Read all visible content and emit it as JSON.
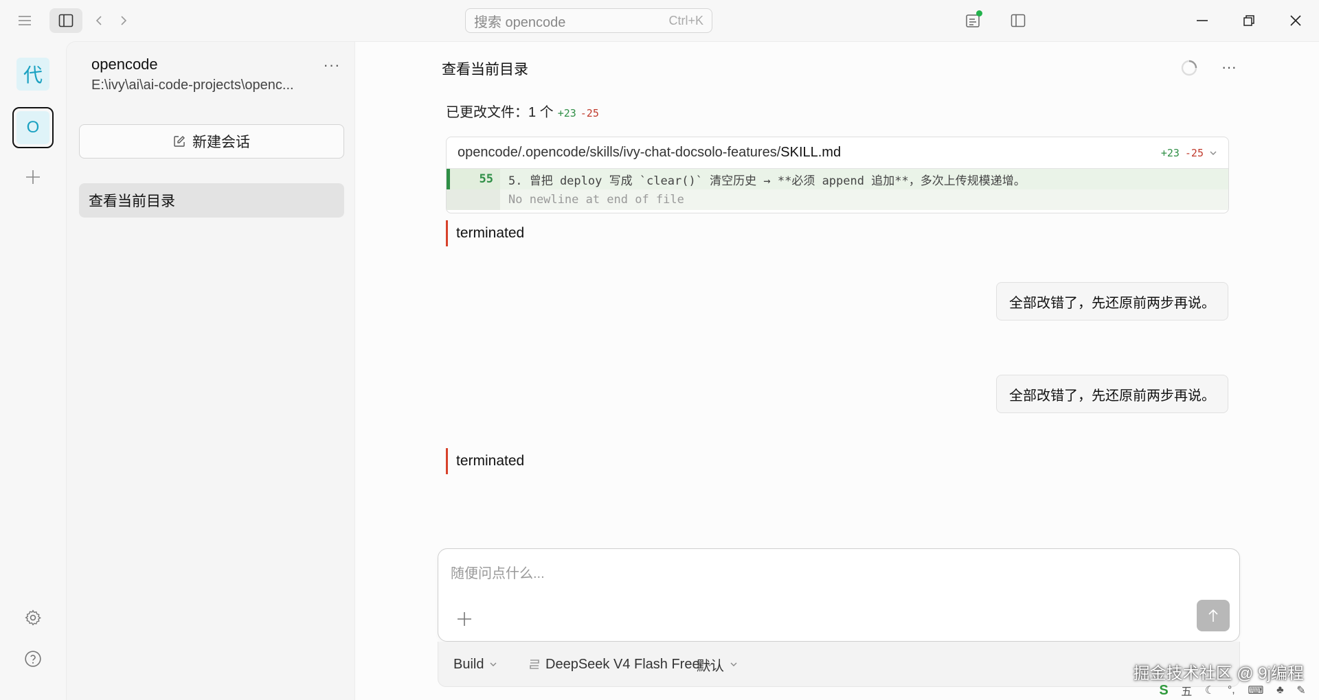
{
  "titlebar": {
    "search_placeholder": "搜索 opencode",
    "search_shortcut": "Ctrl+K",
    "status_dot_color": "#22b24c"
  },
  "rail": {
    "project_avatar_char": "代",
    "active_project_char": "O",
    "avatar_bg": "#dff3f8",
    "avatar_fg": "#1aa1c1"
  },
  "sidebar": {
    "project_name": "opencode",
    "project_path": "E:\\ivy\\ai\\ai-code-projects\\openc...",
    "new_session_label": "新建会话",
    "sessions": [
      {
        "title": "查看当前目录"
      }
    ]
  },
  "session": {
    "title": "查看当前目录",
    "changed_files": {
      "label": "已更改文件：1 个",
      "additions": "+23",
      "deletions": "-25"
    },
    "diff": {
      "path_prefix": "opencode/.opencode/skills/ivy-chat-docsolo-features/",
      "file_name": "SKILL.md",
      "additions": "+23",
      "deletions": "-25",
      "lines": [
        {
          "number": "55",
          "code": "5. 曾把 deploy 写成 `clear()` 清空历史 → **必须 append 追加**，多次上传规模递增。"
        },
        {
          "number": "",
          "code": "No newline at end of file"
        }
      ]
    },
    "messages": [
      {
        "role": "status",
        "text": "terminated"
      },
      {
        "role": "user",
        "text": "全部改错了，先还原前两步再说。"
      },
      {
        "role": "user",
        "text": "全部改错了，先还原前两步再说。"
      },
      {
        "role": "status",
        "text": "terminated"
      }
    ],
    "accent_added": "#2f8f46",
    "accent_deleted": "#c0392b",
    "accent_terminated": "#d7422b"
  },
  "composer": {
    "placeholder": "随便问点什么...",
    "value": "",
    "agent": "Build",
    "model": "DeepSeek V4 Flash Free",
    "variant": "默认"
  },
  "overlay": {
    "watermark": "掘金技术社区 @ 9j编程",
    "ime_logo": "S",
    "ime_mode": "五"
  }
}
